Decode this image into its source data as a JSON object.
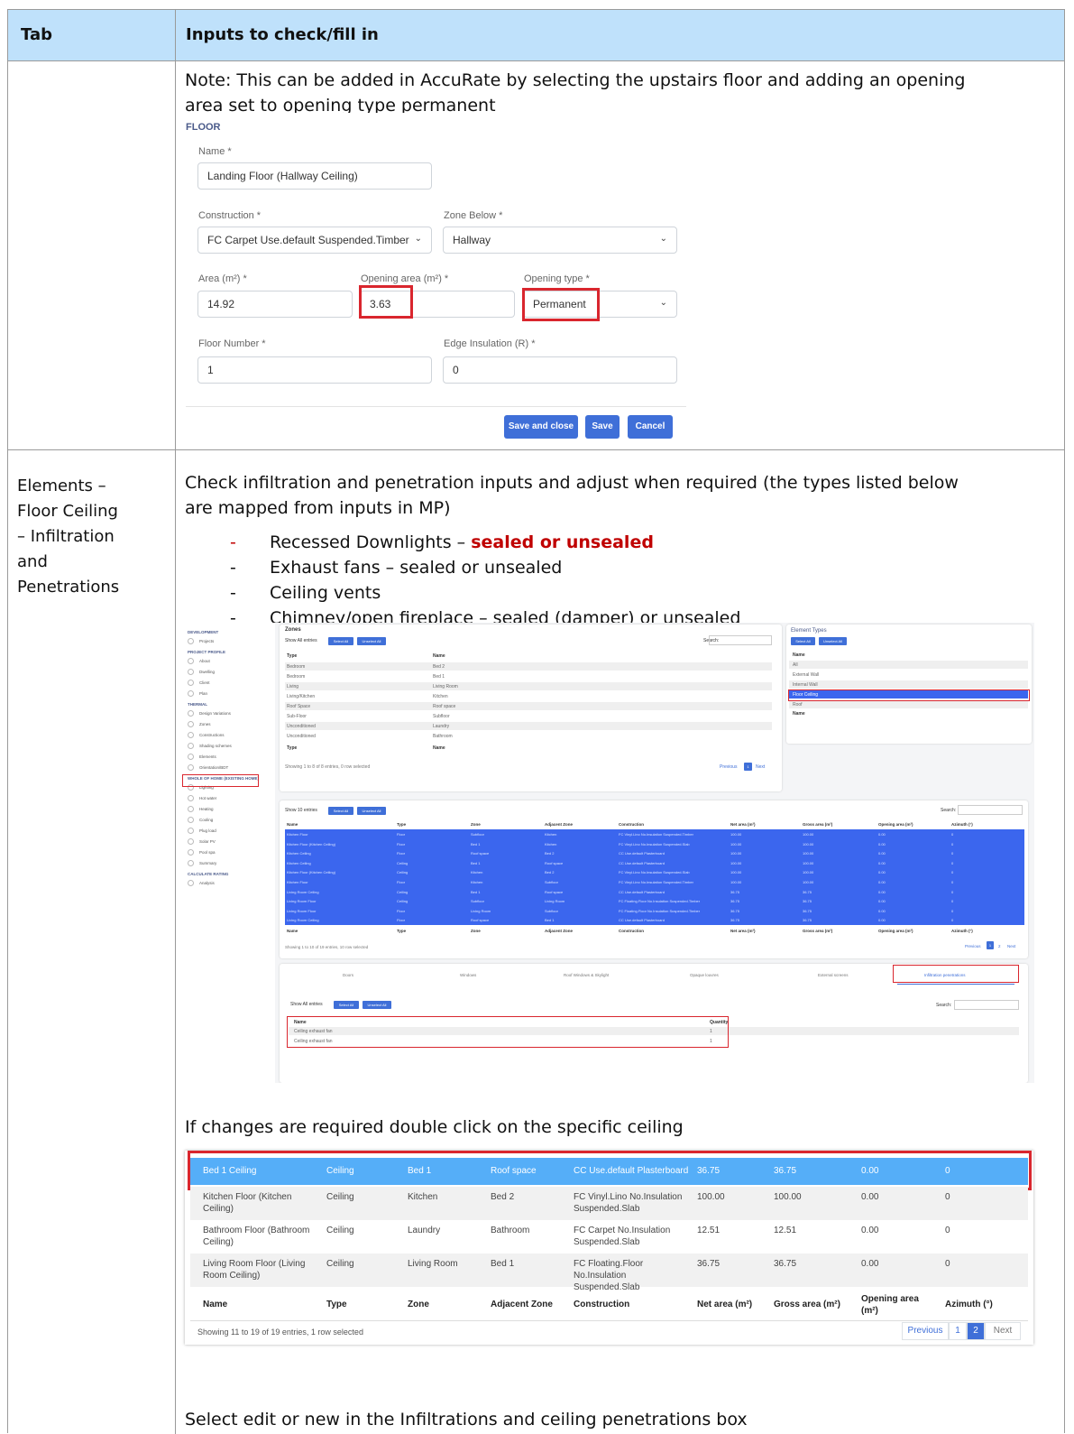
{
  "table": {
    "col1_header": "Tab",
    "col2_header": "Inputs to check/fill in"
  },
  "row1": {
    "note_line1": "Note: This can be added in AccuRate by selecting the upstairs floor and adding an opening",
    "note_line2": "area set to opening type permanent"
  },
  "floor_form": {
    "title": "FLOOR",
    "name_label": "Name *",
    "name_value": "Landing Floor (Hallway Ceiling)",
    "construction_label": "Construction *",
    "construction_value": "FC Carpet Use.default Suspended.Timber",
    "zone_below_label": "Zone Below *",
    "zone_below_value": "Hallway",
    "area_label": "Area (m²) *",
    "area_value": "14.92",
    "opening_area_label": "Opening area (m²) *",
    "opening_area_value": "3.63",
    "opening_type_label": "Opening type *",
    "opening_type_value": "Permanent",
    "floor_number_label": "Floor Number *",
    "floor_number_value": "1",
    "edge_insulation_label": "Edge Insulation (R) *",
    "edge_insulation_value": "0",
    "save_close": "Save and close",
    "save": "Save",
    "cancel": "Cancel"
  },
  "row2": {
    "tab_l1": "Elements –",
    "tab_l2": "Floor Ceiling",
    "tab_l3": "– Infiltration",
    "tab_l4": "and",
    "tab_l5": "Penetrations",
    "intro_l1": "Check infiltration and penetration inputs and adjust when required (the types listed below",
    "intro_l2": "are mapped from inputs in MP)",
    "bullets": [
      {
        "dash": "-",
        "pre": "Recessed Downlights – ",
        "strong": "sealed or unsealed"
      },
      {
        "dash": "-",
        "pre": "Exhaust fans – sealed or unsealed",
        "strong": ""
      },
      {
        "dash": "-",
        "pre": "Ceiling vents",
        "strong": ""
      },
      {
        "dash": "-",
        "pre": "Chimney/open fireplace – sealed (damper) or unsealed",
        "strong": ""
      }
    ],
    "double_click": "If changes are required double click on the specific ceiling",
    "select_edit": "Select edit or new in the Infiltrations and ceiling penetrations box"
  },
  "nav": {
    "items": [
      {
        "t": "DEVELOPMENT",
        "sec": true
      },
      {
        "t": "Projects"
      },
      {
        "t": "PROJECT PROFILE",
        "sec": true
      },
      {
        "t": "About"
      },
      {
        "t": "Dwelling"
      },
      {
        "t": "Client"
      },
      {
        "t": "Plan"
      },
      {
        "t": "THERMAL",
        "sec": true
      },
      {
        "t": "Design Variations"
      },
      {
        "t": "Zones"
      },
      {
        "t": "Constructions"
      },
      {
        "t": "Shading schemes"
      },
      {
        "t": "Elements"
      },
      {
        "t": "Orientation/BDT"
      },
      {
        "t": "WHOLE OF HOME (EXISTING HOME)",
        "sec": true
      },
      {
        "t": "Lighting"
      },
      {
        "t": "Hot water"
      },
      {
        "t": "Heating"
      },
      {
        "t": "Cooling"
      },
      {
        "t": "Plug load"
      },
      {
        "t": "Solar PV"
      },
      {
        "t": "Pool spa"
      },
      {
        "t": "Summary"
      },
      {
        "t": "CALCULATE RATING",
        "sec": true
      },
      {
        "t": "Analysis"
      }
    ]
  },
  "zones_panel": {
    "title": "Zones",
    "show": "Show",
    "all": "All",
    "entries": "entries",
    "select_all": "Select All",
    "unselect_all": "Unselect All",
    "search": "Search:",
    "col_type": "Type",
    "col_name": "Name",
    "rows": [
      [
        "Bedroom",
        "Bed 2"
      ],
      [
        "Bedroom",
        "Bed 1"
      ],
      [
        "Living",
        "Living Room"
      ],
      [
        "Living/Kitchen",
        "Kitchen"
      ],
      [
        "Roof Space",
        "Roof space"
      ],
      [
        "Sub-Floor",
        "Subfloor"
      ],
      [
        "Unconditioned",
        "Laundry"
      ],
      [
        "Unconditioned",
        "Bathroom"
      ]
    ],
    "footer": "Showing 1 to 8 of 8 entries, 0 row selected",
    "prev": "Previous",
    "page": "1",
    "next": "Next"
  },
  "element_types": {
    "title": "Element Types",
    "select_all": "Select All",
    "unselect_all": "Unselect All",
    "col_name": "Name",
    "rows": [
      "All",
      "External Wall",
      "Internal Wall",
      "Floor Ceiling",
      "Roof"
    ]
  },
  "elements_table": {
    "show": "Show",
    "ten": "10",
    "entries": "entries",
    "select_all": "Select All",
    "unselect_all": "Unselect All",
    "search": "Search:",
    "headers": [
      "Name",
      "Type",
      "Zone",
      "Adjacent Zone",
      "Construction",
      "Net area (m²)",
      "Gross area (m²)",
      "Opening area (m²)",
      "Azimuth (°)"
    ],
    "rows": [
      [
        "Kitchen Floor",
        "Floor",
        "Subfloor",
        "Kitchen",
        "FC Vinyl.Lino No.Insulation Suspended.Timber",
        "100.00",
        "100.00",
        "0.00",
        "0"
      ],
      [
        "Kitchen Floor (Kitchen Ceiling)",
        "Floor",
        "Bed 1",
        "Kitchen",
        "FC Vinyl.Lino No.Insulation Suspended.Slab",
        "100.00",
        "100.00",
        "0.00",
        "0"
      ],
      [
        "Kitchen Ceiling",
        "Floor",
        "Roof space",
        "Bed 2",
        "CC Use.default Plasterboard",
        "100.00",
        "100.00",
        "0.00",
        "0"
      ],
      [
        "Kitchen Ceiling",
        "Ceiling",
        "Bed 1",
        "Roof space",
        "CC Use.default Plasterboard",
        "100.00",
        "100.00",
        "0.00",
        "0"
      ],
      [
        "Kitchen Floor (Kitchen Ceiling)",
        "Ceiling",
        "Kitchen",
        "Bed 2",
        "FC Vinyl.Lino No.Insulation Suspended.Slab",
        "100.00",
        "100.00",
        "0.00",
        "0"
      ],
      [
        "Kitchen Floor",
        "Floor",
        "Kitchen",
        "Subfloor",
        "FC Vinyl.Lino No.Insulation Suspended.Timber",
        "100.00",
        "100.00",
        "0.00",
        "0"
      ],
      [
        "Living Room Ceiling",
        "Ceiling",
        "Bed 1",
        "Roof space",
        "CC Use.default Plasterboard",
        "36.75",
        "36.75",
        "0.00",
        "0"
      ],
      [
        "Living Room Floor",
        "Ceiling",
        "Subfloor",
        "Living Room",
        "FC Floating.Floor No.Insulation Suspended.Timber",
        "36.75",
        "36.75",
        "0.00",
        "0"
      ],
      [
        "Living Room Floor",
        "Floor",
        "Living Room",
        "Subfloor",
        "FC Floating.Floor No.Insulation Suspended.Timber",
        "36.75",
        "36.75",
        "0.00",
        "0"
      ],
      [
        "Living Room Ceiling",
        "Floor",
        "Roof space",
        "Bed 1",
        "CC Use.default Plasterboard",
        "36.75",
        "36.75",
        "0.00",
        "0"
      ]
    ],
    "footer": "Showing 1 to 10 of 19 entries, 10 row selected",
    "prev": "Previous",
    "p1": "1",
    "p2": "2",
    "next": "Next"
  },
  "tabs_panel": {
    "tabs": [
      "Doors",
      "Windows",
      "Roof Windows & Skylight",
      "Opaque louvres",
      "External screens",
      "Infiltration penetrations"
    ],
    "show": "Show",
    "all": "All",
    "entries": "entries",
    "select_all": "Select All",
    "unselect_all": "Unselect All",
    "search": "Search:",
    "col_name": "Name",
    "col_qty": "Quantity",
    "rows": [
      [
        "Ceiling exhaust fan",
        "1"
      ],
      [
        "Ceiling exhaust fan",
        "1"
      ]
    ]
  },
  "detail_table": {
    "selected": [
      "Bed 1 Ceiling",
      "Ceiling",
      "Bed 1",
      "Roof space",
      "CC Use.default Plasterboard",
      "36.75",
      "36.75",
      "0.00",
      "0"
    ],
    "rows": [
      [
        "Kitchen Floor (Kitchen Ceiling)",
        "Ceiling",
        "Kitchen",
        "Bed 2",
        "FC Vinyl.Lino No.Insulation Suspended.Slab",
        "100.00",
        "100.00",
        "0.00",
        "0"
      ],
      [
        "Bathroom Floor (Bathroom Ceiling)",
        "Ceiling",
        "Laundry",
        "Bathroom",
        "FC Carpet No.Insulation Suspended.Slab",
        "12.51",
        "12.51",
        "0.00",
        "0"
      ],
      [
        "Living Room Floor (Living Room Ceiling)",
        "Ceiling",
        "Living Room",
        "Bed 1",
        "FC Floating.Floor No.Insulation Suspended.Slab",
        "36.75",
        "36.75",
        "0.00",
        "0"
      ]
    ],
    "headers": [
      "Name",
      "Type",
      "Zone",
      "Adjacent Zone",
      "Construction",
      "Net area (m²)",
      "Gross area (m²)",
      "Opening area (m²)",
      "Azimuth (°)"
    ],
    "footer": "Showing 11 to 19 of 19 entries, 1 row selected",
    "prev": "Previous",
    "p1": "1",
    "p2": "2",
    "next": "Next"
  }
}
